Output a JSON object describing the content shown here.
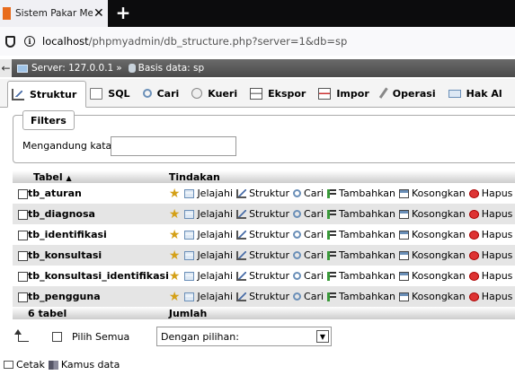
{
  "browser": {
    "tab_title": "Sistem Pakar Metode Forward C",
    "tab_favicon": "pma",
    "url_host": "localhost",
    "url_path": "/phpmyadmin/db_structure.php?server=1&db=sp"
  },
  "breadcrumb": {
    "server_label": "Server: 127.0.0.1",
    "separator": "»",
    "database_label": "Basis data: sp"
  },
  "tabs": [
    {
      "label": "Struktur",
      "icon": "structure-icon"
    },
    {
      "label": "SQL",
      "icon": "sql-icon"
    },
    {
      "label": "Cari",
      "icon": "search-icon"
    },
    {
      "label": "Kueri",
      "icon": "query-icon"
    },
    {
      "label": "Ekspor",
      "icon": "export-icon"
    },
    {
      "label": "Impor",
      "icon": "import-icon"
    },
    {
      "label": "Operasi",
      "icon": "operations-icon"
    },
    {
      "label": "Hak Al",
      "icon": "privileges-icon"
    }
  ],
  "filters": {
    "legend": "Filters",
    "label": "Mengandung kata:",
    "value": ""
  },
  "table": {
    "headers": {
      "tabel": "Tabel",
      "sort": "▲",
      "tindakan": "Tindakan"
    },
    "action_labels": {
      "browse": "Jelajahi",
      "structure": "Struktur",
      "search": "Cari",
      "insert": "Tambahkan",
      "empty": "Kosongkan",
      "drop": "Hapus"
    },
    "rows": [
      {
        "name": "tb_aturan"
      },
      {
        "name": "tb_diagnosa"
      },
      {
        "name": "tb_identifikasi"
      },
      {
        "name": "tb_konsultasi"
      },
      {
        "name": "tb_konsultasi_identifikasi"
      },
      {
        "name": "tb_pengguna"
      }
    ],
    "footer": {
      "count": "6 tabel",
      "sum": "Jumlah"
    }
  },
  "selection": {
    "select_all_label": "Pilih Semua",
    "with_selected": "Dengan pilihan:"
  },
  "bottom": {
    "print_label": "Cetak",
    "dictionary_label": "Kamus data"
  }
}
